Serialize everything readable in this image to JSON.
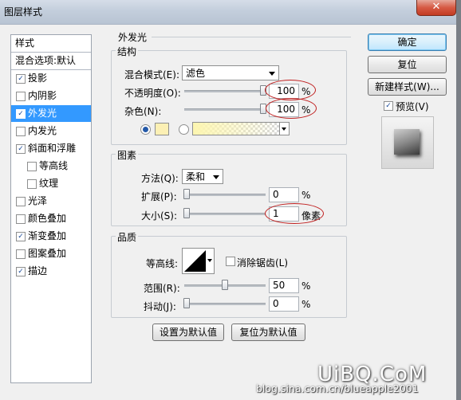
{
  "window": {
    "title": "图层样式",
    "close_label": "✕"
  },
  "sidebar": {
    "header": "样式",
    "blend_item": "混合选项:默认",
    "items": [
      {
        "label": "投影",
        "checked": true
      },
      {
        "label": "内阴影",
        "checked": false
      },
      {
        "label": "外发光",
        "checked": true,
        "selected": true
      },
      {
        "label": "内发光",
        "checked": false
      },
      {
        "label": "斜面和浮雕",
        "checked": true
      },
      {
        "label": "等高线",
        "checked": false,
        "indent": true
      },
      {
        "label": "纹理",
        "checked": false,
        "indent": true
      },
      {
        "label": "光泽",
        "checked": false
      },
      {
        "label": "颜色叠加",
        "checked": false
      },
      {
        "label": "渐变叠加",
        "checked": true
      },
      {
        "label": "图案叠加",
        "checked": false
      },
      {
        "label": "描边",
        "checked": true
      }
    ]
  },
  "outer_glow": {
    "section_title": "外发光",
    "structure": {
      "title": "结构",
      "blend_mode_label": "混合模式(E):",
      "blend_mode_value": "滤色",
      "opacity_label": "不透明度(O):",
      "opacity_value": "100",
      "opacity_unit": "%",
      "noise_label": "杂色(N):",
      "noise_value": "100",
      "noise_unit": "%",
      "solid_color": "#fcf0b4",
      "gradient_color": "#fdf6b0"
    },
    "elements": {
      "title": "图素",
      "method_label": "方法(Q):",
      "method_value": "柔和",
      "spread_label": "扩展(P):",
      "spread_value": "0",
      "spread_unit": "%",
      "size_label": "大小(S):",
      "size_value": "1",
      "size_unit": "像素"
    },
    "quality": {
      "title": "品质",
      "contour_label": "等高线:",
      "antialias_label": "消除锯齿(L)",
      "antialias_checked": false,
      "range_label": "范围(R):",
      "range_value": "50",
      "range_unit": "%",
      "jitter_label": "抖动(J):",
      "jitter_value": "0",
      "jitter_unit": "%"
    },
    "make_default": "设置为默认值",
    "reset_default": "复位为默认值"
  },
  "actions": {
    "ok": "确定",
    "reset": "复位",
    "new_style": "新建样式(W)...",
    "preview_label": "预览(V)",
    "preview_checked": true
  },
  "slider_levels": {
    "opacity": 1.0,
    "noise": 1.0,
    "spread": 0.0,
    "size": 0.0,
    "range": 0.5,
    "jitter": 0.0
  },
  "watermark": {
    "logo": "UiBQ.CoM",
    "url": "blog.sina.com.cn/blueapple2001"
  }
}
